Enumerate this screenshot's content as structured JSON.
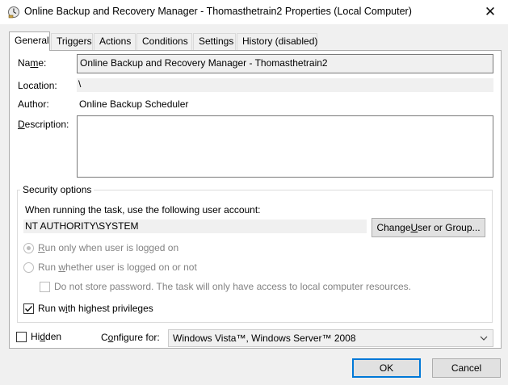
{
  "window": {
    "title": "Online Backup and Recovery Manager - Thomasthetrain2 Properties (Local Computer)",
    "close_glyph": "✕",
    "icon": "clock-task-icon"
  },
  "tabs": [
    {
      "label": "General",
      "active": true
    },
    {
      "label": "Triggers"
    },
    {
      "label": "Actions"
    },
    {
      "label": "Conditions"
    },
    {
      "label": "Settings"
    },
    {
      "label": "History (disabled)"
    }
  ],
  "general": {
    "name_label_pre": "Na",
    "name_label_u": "m",
    "name_label_post": "e:",
    "name_value": "Online Backup and Recovery Manager - Thomasthetrain2",
    "location_label": "Location:",
    "location_value": "\\",
    "author_label": "Author:",
    "author_value": "Online Backup Scheduler",
    "description_label_u": "D",
    "description_label_post": "escription:",
    "description_value": ""
  },
  "security": {
    "group_title": "Security options",
    "account_prompt": "When running the task, use the following user account:",
    "account_value": "NT AUTHORITY\\SYSTEM",
    "change_button_pre": "Change ",
    "change_button_u": "U",
    "change_button_post": "ser or Group...",
    "radio_logged_on_u": "R",
    "radio_logged_on_post": "un only when user is logged on",
    "radio_whether_pre": "Run ",
    "radio_whether_u": "w",
    "radio_whether_post": "hether user is logged on or not",
    "no_store_pwd": "Do not store password.  The task will only have access to local computer resources.",
    "highest_priv_pre": "Run w",
    "highest_priv_u": "i",
    "highest_priv_post": "th highest privileges",
    "highest_priv_checked": true
  },
  "bottom": {
    "hidden_pre": "Hi",
    "hidden_u": "d",
    "hidden_post": "den",
    "configure_pre": "C",
    "configure_u": "o",
    "configure_post": "nfigure for:",
    "configure_value": "Windows Vista™, Windows Server™ 2008"
  },
  "buttons": {
    "ok": "OK",
    "cancel": "Cancel"
  }
}
